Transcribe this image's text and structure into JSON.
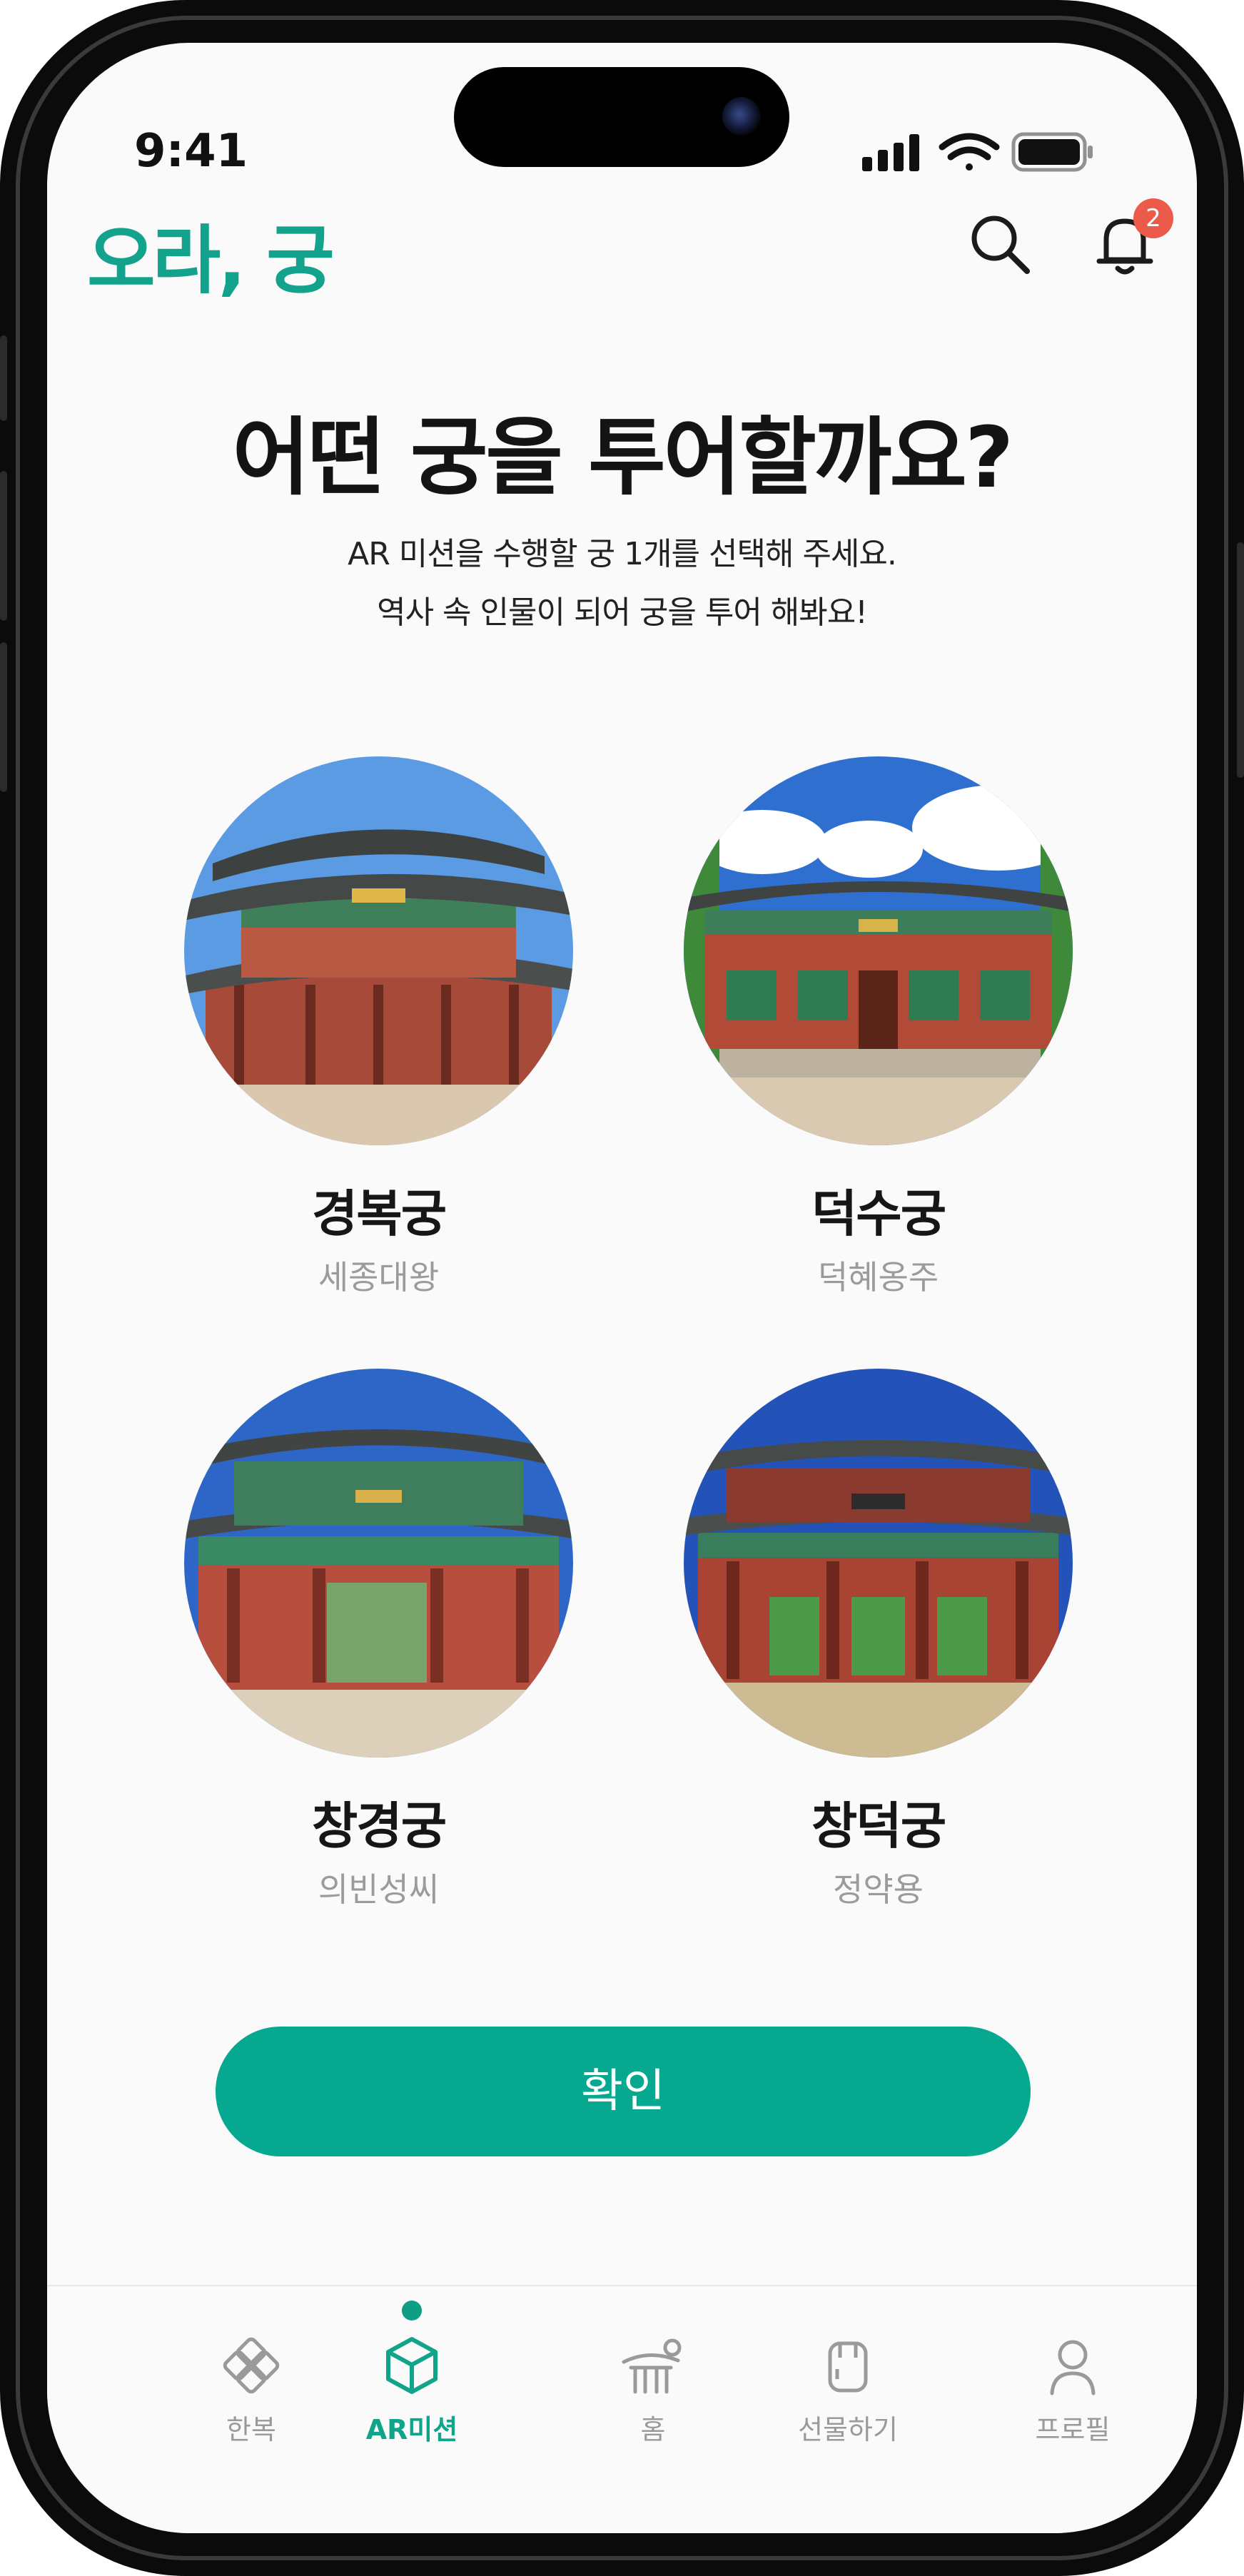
{
  "status": {
    "time": "9:41"
  },
  "header": {
    "logo": "오라, 궁",
    "notification_count": "2"
  },
  "heading": {
    "title": "어떤 궁을 투어할까요?",
    "subtitle_line1": "AR 미션을 수행할 궁 1개를 선택해 주세요.",
    "subtitle_line2": "역사 속 인물이 되어 궁을 투어 해봐요!"
  },
  "palaces": [
    {
      "name": "경복궁",
      "person": "세종대왕"
    },
    {
      "name": "덕수궁",
      "person": "덕혜옹주"
    },
    {
      "name": "창경궁",
      "person": "의빈성씨"
    },
    {
      "name": "창덕궁",
      "person": "정약용"
    }
  ],
  "confirm_label": "확인",
  "tabs": [
    {
      "label": "한복",
      "icon": "hanbok-knot-icon"
    },
    {
      "label": "AR미션",
      "icon": "ar-cube-icon",
      "active": true
    },
    {
      "label": "홈",
      "icon": "home-palace-icon"
    },
    {
      "label": "선물하기",
      "icon": "gift-icon"
    },
    {
      "label": "프로필",
      "icon": "profile-icon"
    }
  ],
  "colors": {
    "accent": "#06a88f",
    "logo": "#13a38d",
    "badge": "#ec5b4a"
  }
}
